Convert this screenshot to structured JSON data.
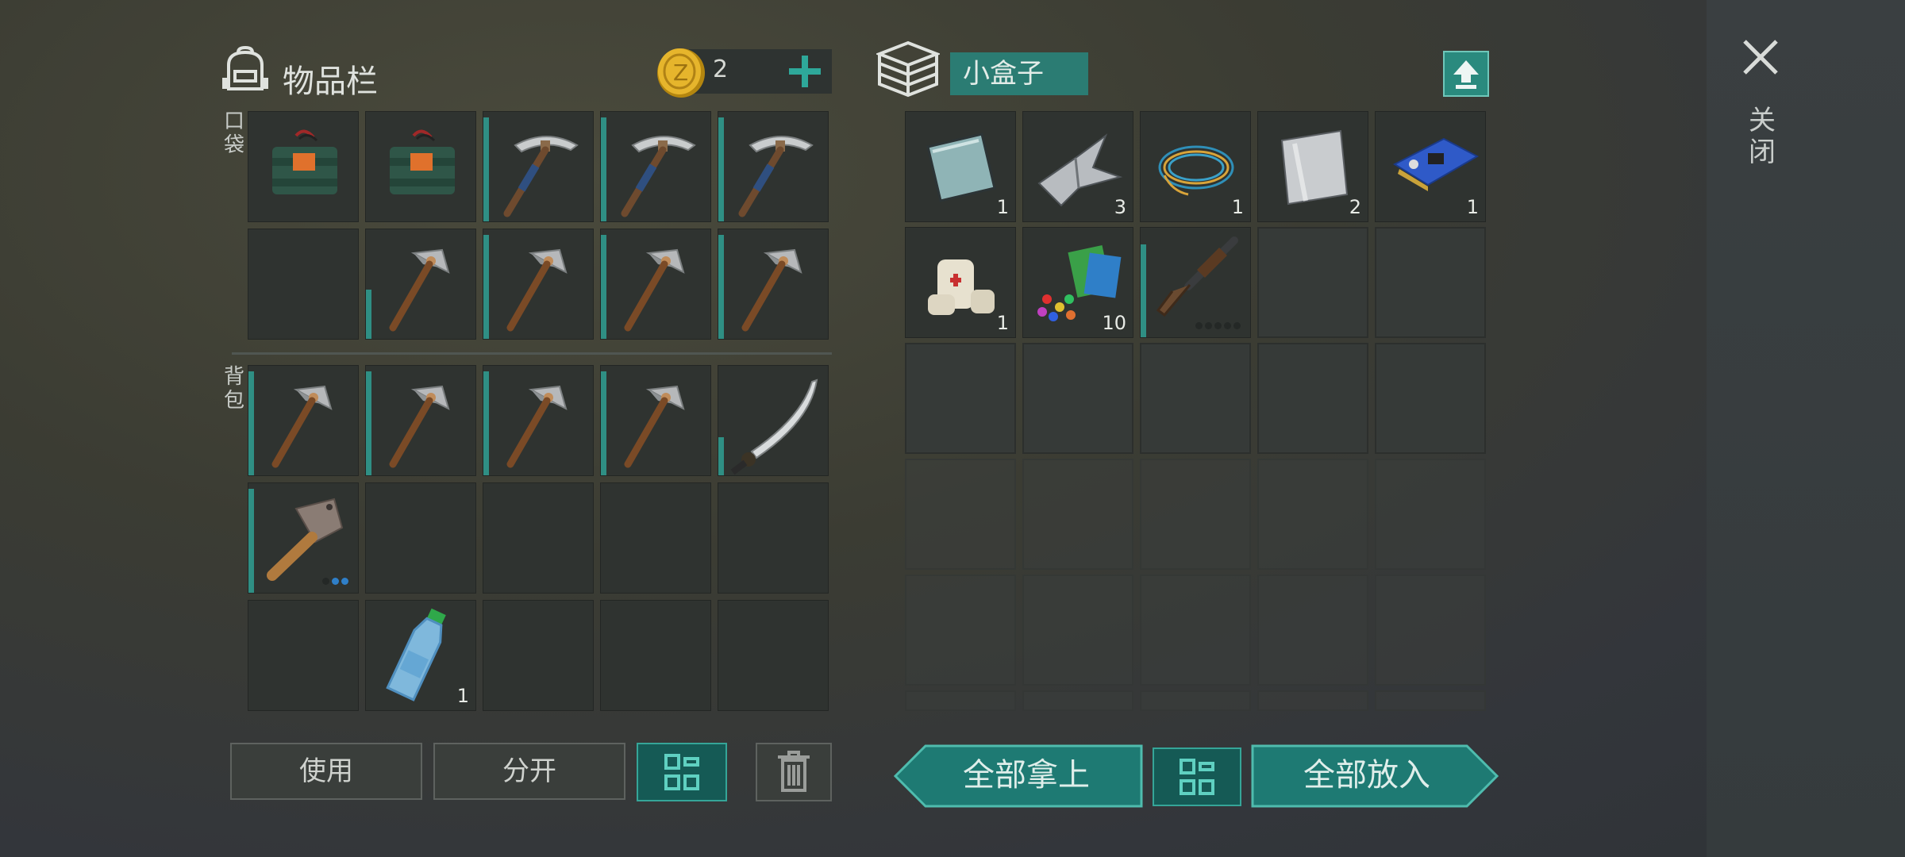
{
  "inventory": {
    "title": "物品栏",
    "coins": "2",
    "pocket_label": "口袋",
    "backpack_label": "背包",
    "pocket_slots": [
      {
        "item": "battery-pack",
        "qty": ""
      },
      {
        "item": "battery-pack",
        "qty": ""
      },
      {
        "item": "pickaxe-blue",
        "qty": "",
        "durability": 0.95
      },
      {
        "item": "pickaxe-blue",
        "qty": "",
        "durability": 0.95
      },
      {
        "item": "pickaxe-blue",
        "qty": "",
        "durability": 0.95
      },
      {
        "item": "",
        "qty": ""
      },
      {
        "item": "pickaxe-stone",
        "qty": "",
        "durability": 0.45
      },
      {
        "item": "pickaxe-stone",
        "qty": "",
        "durability": 0.95
      },
      {
        "item": "pickaxe-stone",
        "qty": "",
        "durability": 0.95
      },
      {
        "item": "pickaxe-stone",
        "qty": "",
        "durability": 0.95
      }
    ],
    "backpack_slots": [
      {
        "item": "pickaxe-stone",
        "qty": "",
        "durability": 0.95
      },
      {
        "item": "pickaxe-stone",
        "qty": "",
        "durability": 0.95
      },
      {
        "item": "pickaxe-stone",
        "qty": "",
        "durability": 0.95
      },
      {
        "item": "pickaxe-stone",
        "qty": "",
        "durability": 0.95
      },
      {
        "item": "katana",
        "qty": "",
        "durability": 0.35
      },
      {
        "item": "cleaver",
        "qty": "",
        "durability": 0.95
      },
      {
        "item": "",
        "qty": ""
      },
      {
        "item": "",
        "qty": ""
      },
      {
        "item": "",
        "qty": ""
      },
      {
        "item": "",
        "qty": ""
      },
      {
        "item": "",
        "qty": ""
      },
      {
        "item": "water-bottle",
        "qty": "1"
      },
      {
        "item": "",
        "qty": ""
      },
      {
        "item": "",
        "qty": ""
      },
      {
        "item": "",
        "qty": ""
      }
    ],
    "buttons": {
      "use": "使用",
      "split": "分开"
    }
  },
  "box": {
    "name": "小盒子",
    "slots": [
      {
        "item": "glass-plate",
        "qty": "1"
      },
      {
        "item": "metal-scrap",
        "qty": "3"
      },
      {
        "item": "wire",
        "qty": "1"
      },
      {
        "item": "steel-sheet",
        "qty": "2"
      },
      {
        "item": "circuit-board",
        "qty": "1"
      },
      {
        "item": "bandage",
        "qty": "1"
      },
      {
        "item": "pills-and-cards",
        "qty": "10"
      },
      {
        "item": "shotgun",
        "qty": "",
        "durability": 0.85
      }
    ],
    "buttons": {
      "take_all": "全部拿上",
      "put_all": "全部放入"
    }
  },
  "close_label": "关闭",
  "colors": {
    "accent": "#2a8a7e",
    "durability": "#2f8f84"
  }
}
